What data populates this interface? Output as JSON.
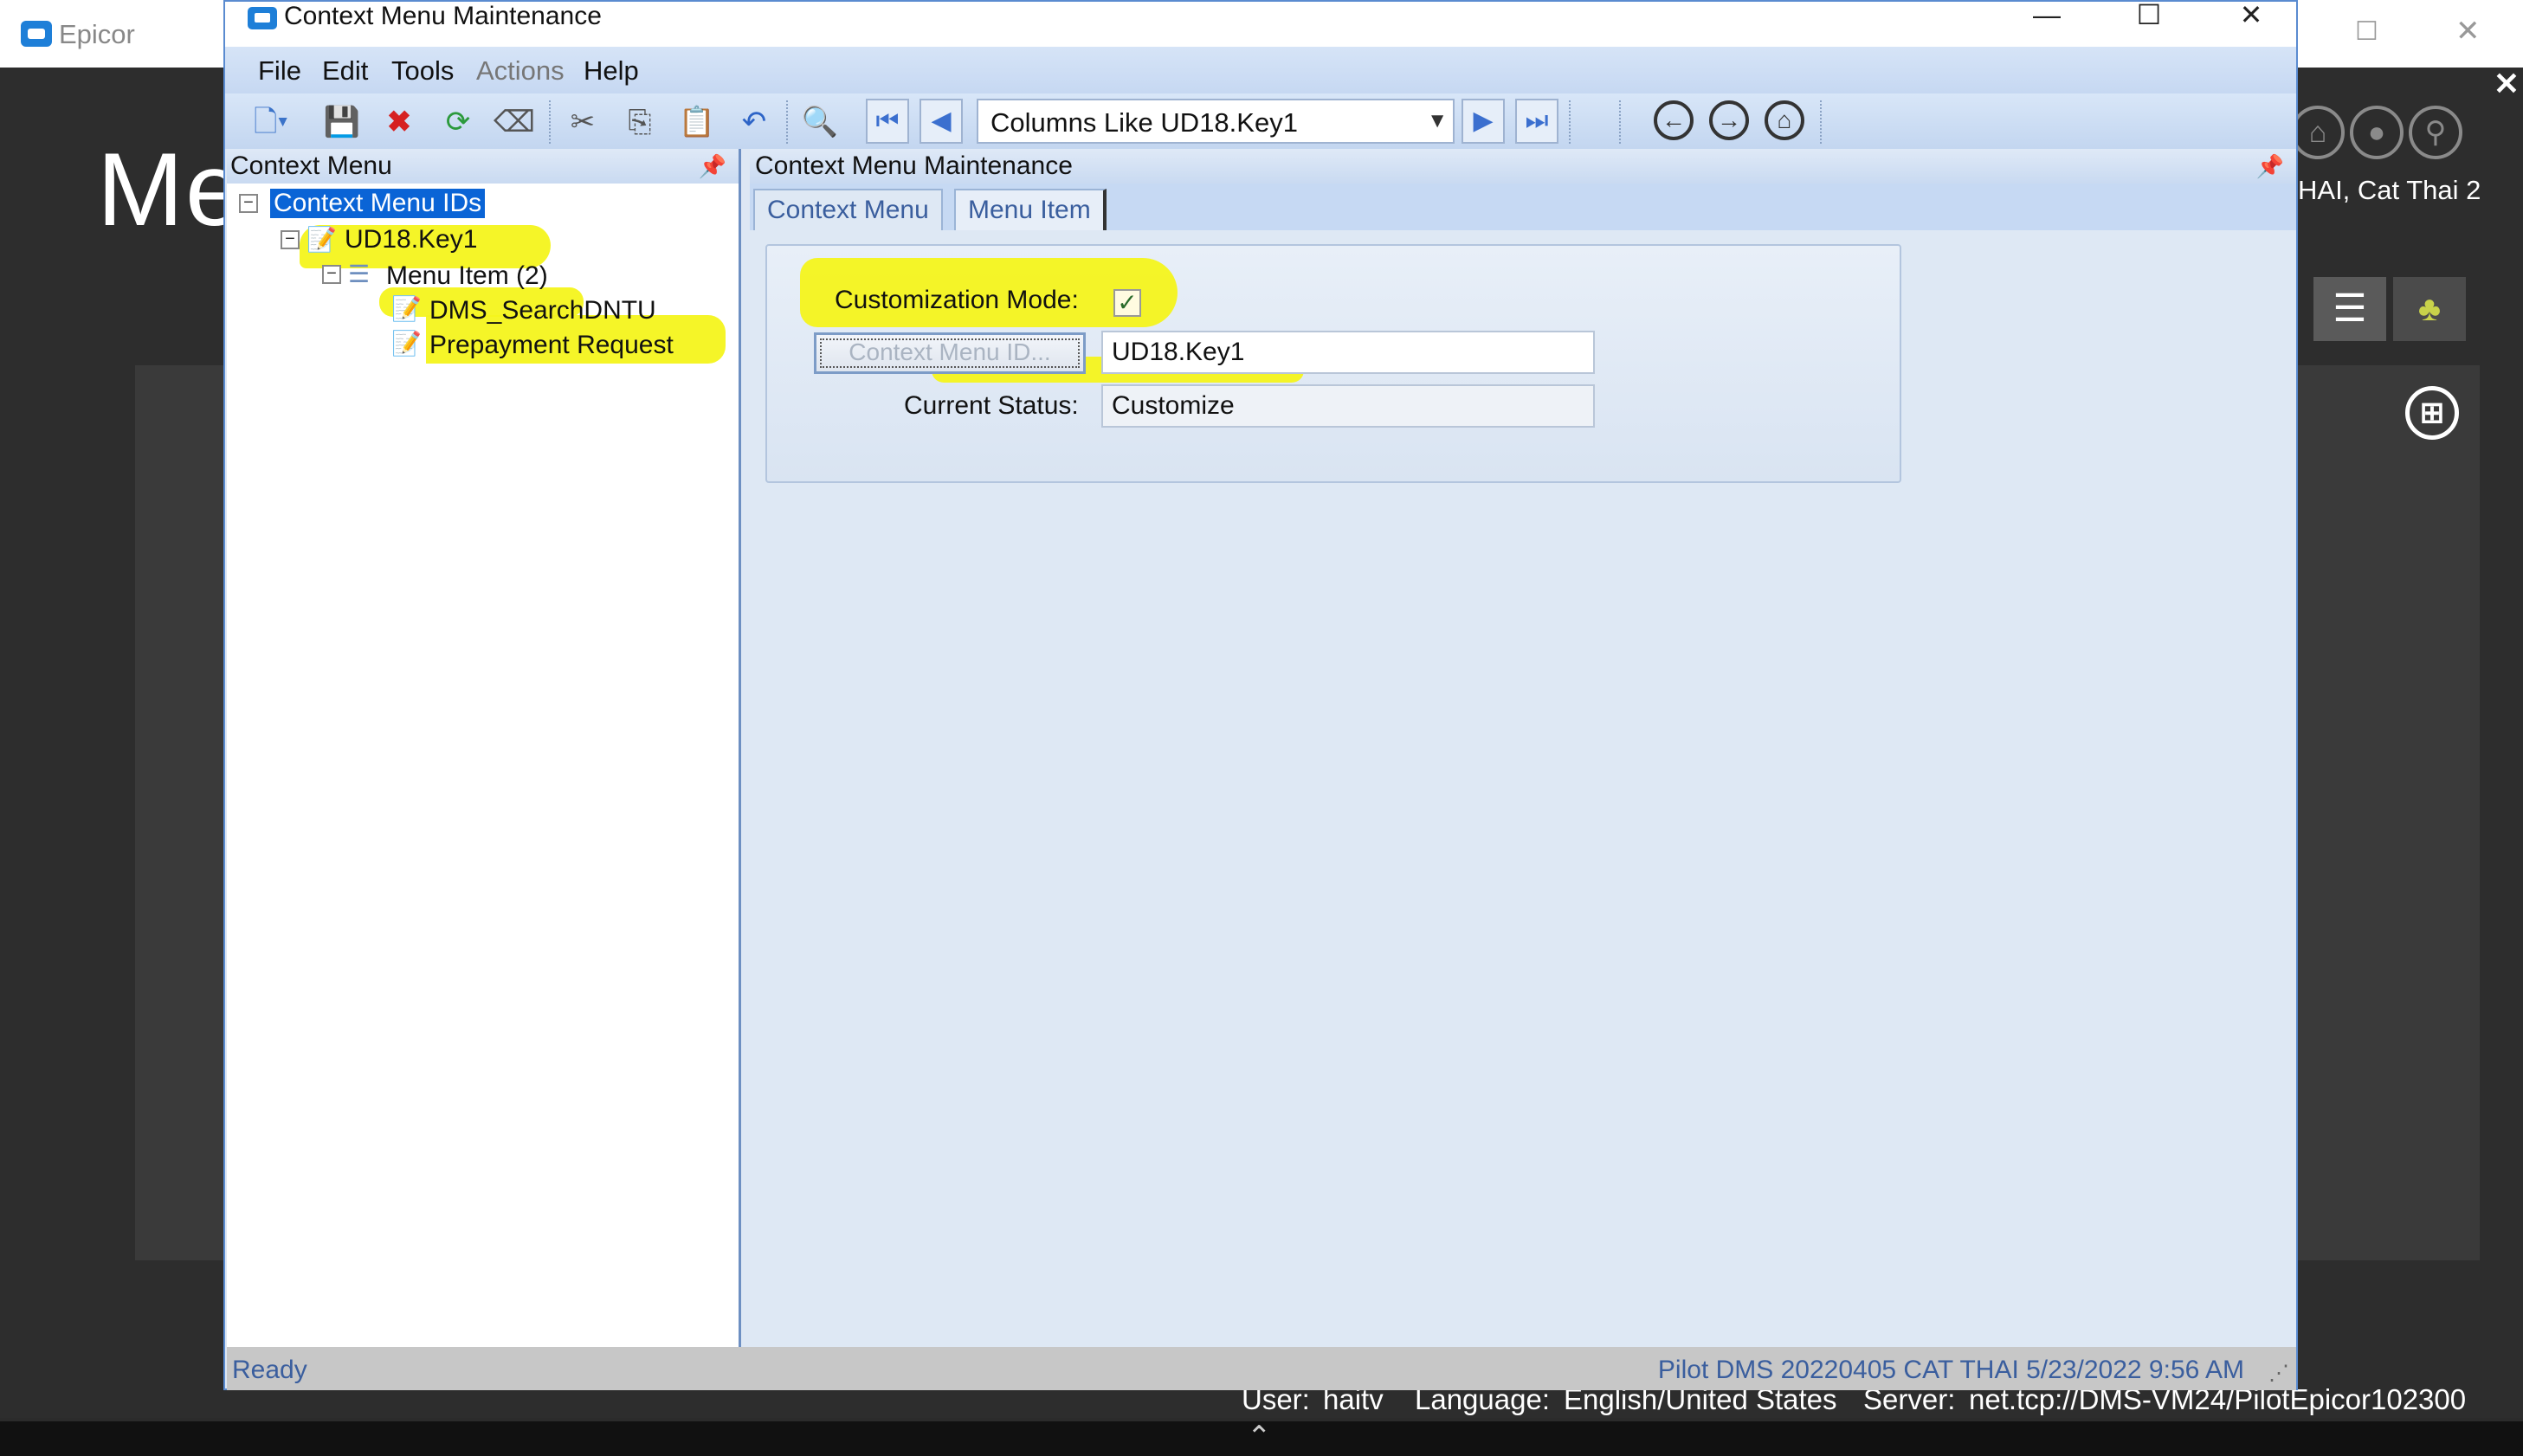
{
  "background_app": {
    "title": "Epicor",
    "heading": "Me",
    "user_display": "HAI, Cat Thai 2",
    "status": {
      "user_label": "User:",
      "user": "haitv",
      "language_label": "Language:",
      "language": "English/United States",
      "server_label": "Server:",
      "server": "net.tcp://DMS-VM24/PilotEpicor102300"
    }
  },
  "window": {
    "title": "Context Menu Maintenance",
    "controls": {
      "minimize": "—",
      "maximize": "☐",
      "close": "✕"
    }
  },
  "menu": [
    "File",
    "Edit",
    "Tools",
    "Actions",
    "Help"
  ],
  "toolbar": {
    "filter_text": "Columns Like UD18.Key1",
    "icons": [
      "new-icon",
      "save-icon",
      "delete-icon",
      "refresh-icon",
      "clear-icon",
      "cut-icon",
      "copy-icon",
      "paste-icon",
      "undo-icon",
      "search-icon",
      "first-record-icon",
      "previous-record-icon",
      "next-record-icon",
      "last-record-icon",
      "back-icon",
      "forward-icon",
      "home-icon"
    ]
  },
  "left_pane": {
    "header": "Context Menu",
    "tree": {
      "root": "Context Menu IDs",
      "node": "UD18.Key1",
      "group": "Menu Item (2)",
      "items": [
        "DMS_SearchDNTU",
        "Prepayment Request"
      ]
    }
  },
  "right_pane": {
    "header": "Context Menu Maintenance",
    "tabs": [
      "Context Menu",
      "Menu Item"
    ],
    "form": {
      "customization_mode_label": "Customization Mode:",
      "customization_mode_checked": true,
      "context_menu_id_button": "Context Menu ID...",
      "context_menu_id_value": "UD18.Key1",
      "current_status_label": "Current Status:",
      "current_status_value": "Customize"
    }
  },
  "statusbar": {
    "left": "Ready",
    "right": "Pilot DMS 20220405 CAT THAI   5/23/2022    9:56 AM"
  },
  "colors": {
    "highlight": "#f4f41c",
    "selection": "#0a64d6",
    "accent": "#3a5e9e"
  }
}
